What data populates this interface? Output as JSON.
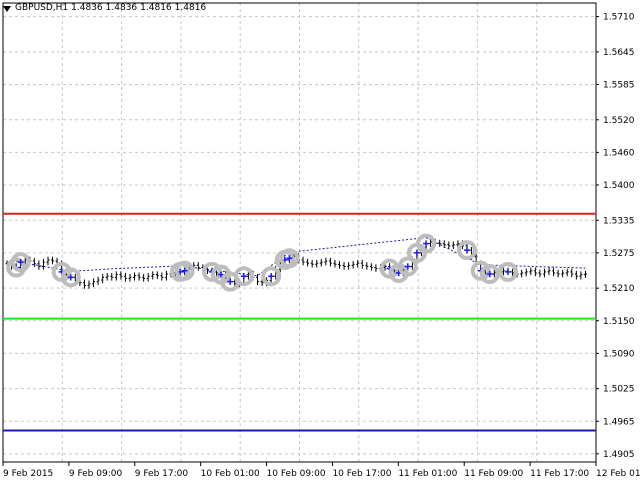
{
  "window": {
    "symbol_label": "GBPUSD,H1",
    "open": "1.4836",
    "high": "1.4836",
    "low": "1.4816",
    "close": "1.4816",
    "menu_icon": "triangle-down-icon"
  },
  "colors": {
    "background": "#ffffff",
    "grid": "#c8c8c8",
    "candles": "#000000",
    "red_level": "#d9241c",
    "green_level": "#1ee61e",
    "blue_level": "#1a1aa8",
    "marker_circle": "#bdbdbd",
    "marker_arrow": "#1a1aff",
    "trend_line": "#1a1aa8"
  },
  "levels": {
    "red": 1.5347,
    "green": 1.5154,
    "blue": 1.4948
  },
  "chart_data": {
    "type": "line",
    "title": "",
    "y_axis_labels": [
      "1.5710",
      "1.5645",
      "1.5585",
      "1.5520",
      "1.5460",
      "1.5400",
      "1.5335",
      "1.5275",
      "1.5210",
      "1.5150",
      "1.5090",
      "1.5025",
      "1.4965",
      "1.4905"
    ],
    "ylim": [
      1.489,
      1.5735
    ],
    "x_axis_labels": [
      "9 Feb 2015",
      "9 Feb 09:00",
      "9 Feb 17:00",
      "10 Feb 01:00",
      "10 Feb 09:00",
      "10 Feb 17:00",
      "11 Feb 01:00",
      "11 Feb 09:00",
      "11 Feb 17:00",
      "12 Feb 01:00"
    ],
    "grid": true,
    "series": [
      {
        "values": [
          1.5255,
          1.525,
          1.5248,
          1.5258,
          1.5262,
          1.526,
          1.5255,
          1.525,
          1.5258,
          1.5262,
          1.526,
          1.5255,
          1.524,
          1.5235,
          1.523,
          1.5224,
          1.522,
          1.5215,
          1.5218,
          1.5222,
          1.5225,
          1.523,
          1.5232,
          1.523,
          1.5235,
          1.5232,
          1.5228,
          1.523,
          1.5233,
          1.523,
          1.5228,
          1.5232,
          1.5235,
          1.5233,
          1.523,
          1.5236,
          1.5238,
          1.5235,
          1.524,
          1.5242,
          1.5245,
          1.5252,
          1.5248,
          1.5245,
          1.5242,
          1.524,
          1.5238,
          1.5235,
          1.523,
          1.5222,
          1.5218,
          1.522,
          1.5232,
          1.5236,
          1.523,
          1.5222,
          1.522,
          1.5224,
          1.5232,
          1.5245,
          1.5255,
          1.5262,
          1.5265,
          1.5268,
          1.5262,
          1.5258,
          1.5256,
          1.5254,
          1.5256,
          1.5258,
          1.526,
          1.5256,
          1.5254,
          1.5252,
          1.525,
          1.5252,
          1.5254,
          1.5256,
          1.5252,
          1.525,
          1.5248,
          1.5246,
          1.5248,
          1.525,
          1.5246,
          1.5242,
          1.5238,
          1.5242,
          1.525,
          1.5262,
          1.5275,
          1.5285,
          1.5292,
          1.5295,
          1.5293,
          1.5292,
          1.529,
          1.5288,
          1.529,
          1.5292,
          1.5288,
          1.528,
          1.5268,
          1.5255,
          1.5242,
          1.5238,
          1.5236,
          1.5238,
          1.524,
          1.5242,
          1.524,
          1.5238,
          1.5236,
          1.5238,
          1.524,
          1.5242,
          1.5238,
          1.5236,
          1.524,
          1.5242,
          1.5238,
          1.5236,
          1.5238,
          1.524,
          1.5236,
          1.5232,
          1.5235,
          1.5236
        ]
      }
    ]
  }
}
